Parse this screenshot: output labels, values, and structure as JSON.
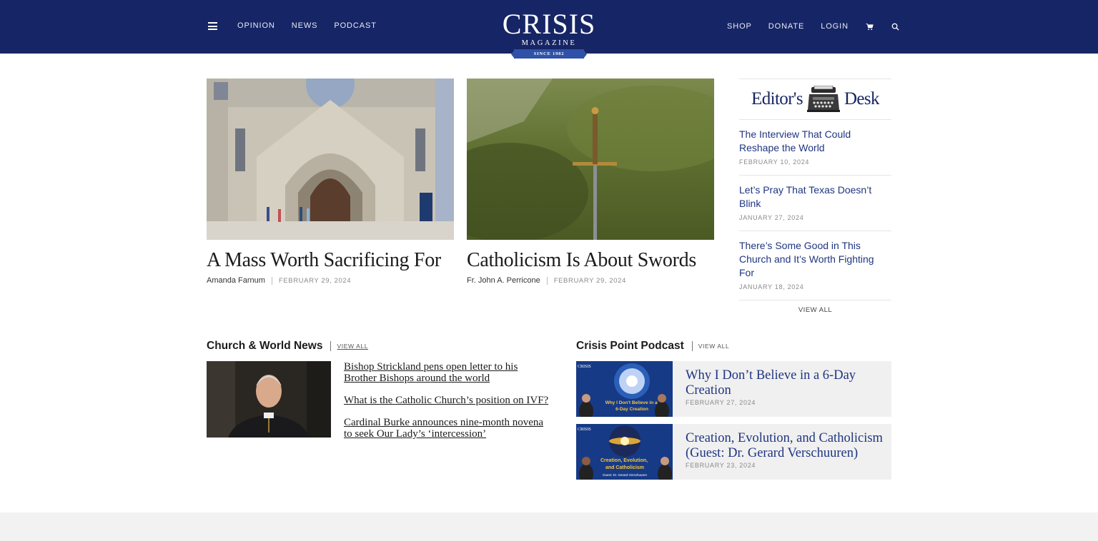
{
  "header": {
    "nav_left": [
      "OPINION",
      "NEWS",
      "PODCAST"
    ],
    "nav_right": [
      "SHOP",
      "DONATE",
      "LOGIN"
    ],
    "logo_title": "CRISIS",
    "logo_subtitle": "MAGAZINE",
    "logo_ribbon": "SINCE 1982",
    "icons": [
      "menu-icon",
      "cart-icon",
      "search-icon"
    ],
    "bg_color": "#162565"
  },
  "featured": [
    {
      "title": "A Mass Worth Sacrificing For",
      "author": "Amanda Farnum",
      "date": "FEBRUARY 29, 2024"
    },
    {
      "title": "Catholicism Is About Swords",
      "author": "Fr. John A. Perricone",
      "date": "FEBRUARY 29, 2024"
    }
  ],
  "editors_desk": {
    "heading_left": "Editor's",
    "heading_right": "Desk",
    "items": [
      {
        "title": "The Interview That Could Reshape the World",
        "date": "FEBRUARY 10, 2024"
      },
      {
        "title": "Let’s Pray That Texas Doesn’t Blink",
        "date": "JANUARY 27, 2024"
      },
      {
        "title": "There’s Some Good in This Church and It’s Worth Fighting For",
        "date": "JANUARY 18, 2024"
      }
    ],
    "view_all": "VIEW ALL"
  },
  "news": {
    "title": "Church & World News",
    "view_all": "VIEW ALL",
    "links": [
      "Bishop Strickland pens open letter to his Brother Bishops around the world",
      "What is the Catholic Church’s position on IVF?",
      "Cardinal Burke announces nine-month novena to seek Our Lady’s ‘intercession’"
    ]
  },
  "podcast": {
    "title": "Crisis Point Podcast",
    "view_all": "VIEW ALL",
    "items": [
      {
        "title": "Why I Don’t Believe in a 6-Day Creation",
        "date": "FEBRUARY 27, 2024",
        "thumb_text": "Why I Don't Believe in a 6-Day Creation"
      },
      {
        "title": "Creation, Evolution, and Catholicism (Guest: Dr. Gerard Verschuuren)",
        "date": "FEBRUARY 23, 2024",
        "thumb_text": "Creation, Evolution, and Catholicism",
        "thumb_guest": "Guest: Dr. Gerard Verschuuren"
      }
    ],
    "thumb_badge": "CRISIS"
  }
}
